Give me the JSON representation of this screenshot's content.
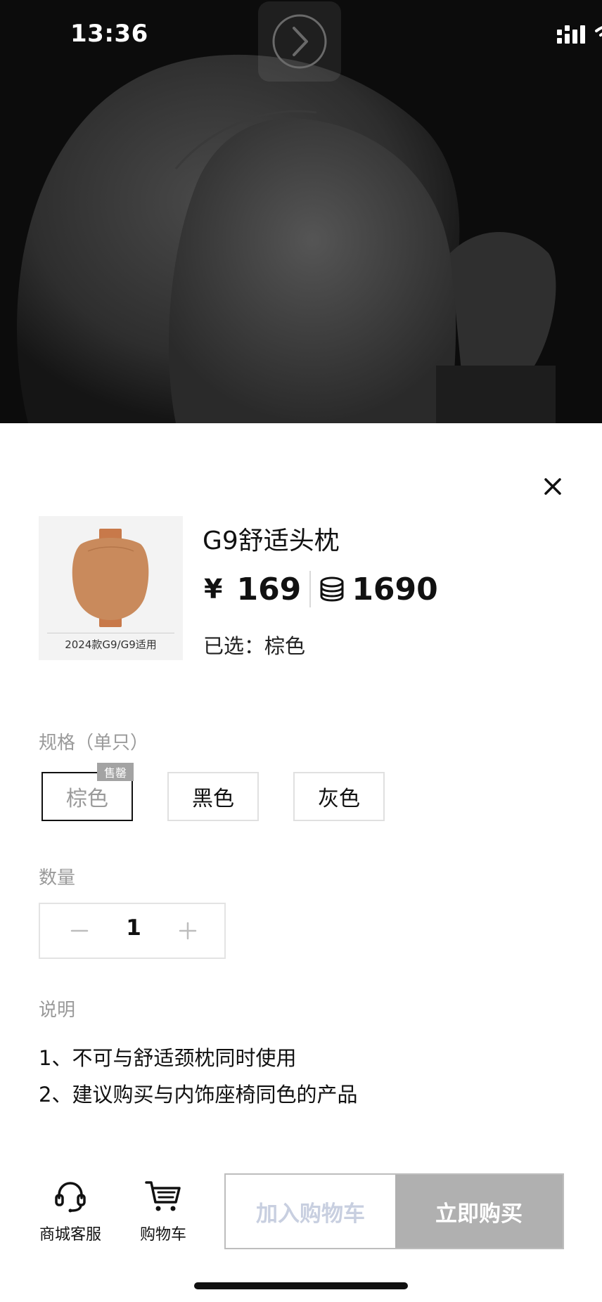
{
  "status_bar": {
    "time": "13:36"
  },
  "product": {
    "thumbnail_caption": "2024款G9/G9适用",
    "title": "G9舒适头枕",
    "currency_symbol": "¥",
    "price": "169",
    "points": "1690",
    "selected_label": "已选：",
    "selected_value": "棕色"
  },
  "spec": {
    "label": "规格（单只）",
    "sold_out_tag": "售罄",
    "options": [
      {
        "label": "棕色",
        "selected": true,
        "sold_out": true
      },
      {
        "label": "黑色",
        "selected": false,
        "sold_out": false
      },
      {
        "label": "灰色",
        "selected": false,
        "sold_out": false
      }
    ]
  },
  "quantity": {
    "label": "数量",
    "value": "1"
  },
  "description": {
    "label": "说明",
    "lines": [
      "1、不可与舒适颈枕同时使用",
      "2、建议购买与内饰座椅同色的产品"
    ]
  },
  "bottom_bar": {
    "service_label": "商城客服",
    "cart_label": "购物车",
    "add_to_cart": "加入购物车",
    "buy_now": "立即购买"
  },
  "colors": {
    "accent_dark": "#111111",
    "muted_text": "#9a9a9a",
    "disabled_button": "#b0b0b0",
    "disabled_add_cart_text": "#c8cfe0"
  },
  "icons": {
    "close": "close-icon",
    "coin": "coin-icon",
    "minus": "minus-icon",
    "plus": "plus-icon",
    "service": "headset-icon",
    "cart": "cart-icon",
    "nav": "chevron-right-icon",
    "signal": "signal-icon",
    "wifi": "wifi-icon",
    "battery": "battery-icon"
  }
}
